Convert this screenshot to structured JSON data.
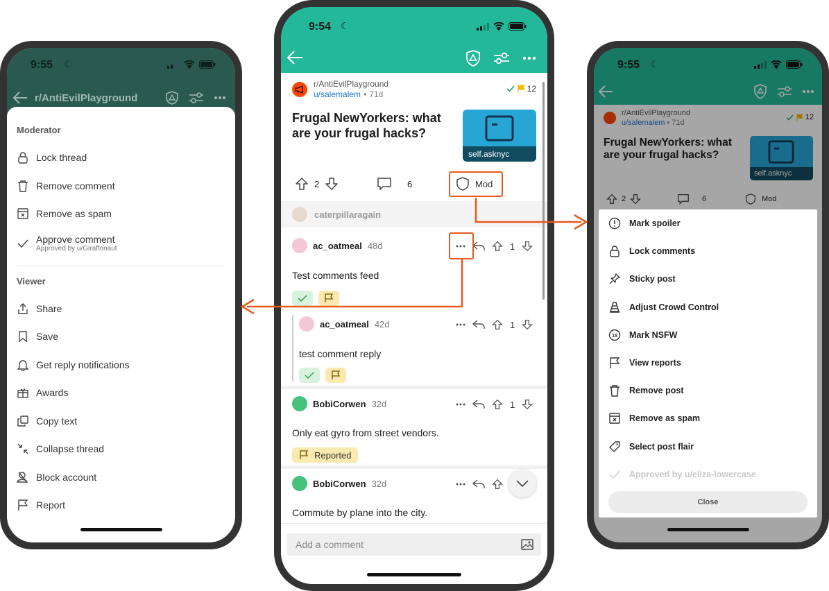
{
  "left_phone": {
    "status": {
      "time": "9:55"
    },
    "appbar": {
      "title": "r/AntiEvilPlayground"
    },
    "moderator_section": {
      "heading": "Moderator",
      "items": [
        {
          "label": "Lock thread",
          "icon": "lock-icon"
        },
        {
          "label": "Remove comment",
          "icon": "trash-icon"
        },
        {
          "label": "Remove as spam",
          "icon": "spam-icon"
        },
        {
          "label": "Approve comment",
          "sublabel": "Approved by u/Giraffonaut",
          "icon": "check-icon"
        }
      ]
    },
    "viewer_section": {
      "heading": "Viewer",
      "items": [
        {
          "label": "Share",
          "icon": "share-icon"
        },
        {
          "label": "Save",
          "icon": "bookmark-icon"
        },
        {
          "label": "Get reply notifications",
          "icon": "bell-icon"
        },
        {
          "label": "Awards",
          "icon": "gift-icon"
        },
        {
          "label": "Copy text",
          "icon": "copy-icon"
        },
        {
          "label": "Collapse thread",
          "icon": "collapse-icon"
        },
        {
          "label": "Block account",
          "icon": "block-user-icon"
        },
        {
          "label": "Report",
          "icon": "flag-icon"
        }
      ]
    }
  },
  "center_phone": {
    "status": {
      "time": "9:54"
    },
    "post": {
      "subreddit": "r/AntiEvilPlayground",
      "author": "u/salemalem",
      "age": "71d",
      "reports_count": "12",
      "title": "Frugal NewYorkers: what are your frugal hacks?",
      "thumbnail_label": "self.asknyc",
      "votes": "2",
      "comments": "6",
      "mod_label": "Mod"
    },
    "collapsed_user": "caterpillaragain",
    "comments": [
      {
        "author": "ac_oatmeal",
        "age": "48d",
        "body": "Test comments feed",
        "votes": "1",
        "chips": [
          "approve",
          "flag"
        ]
      },
      {
        "author": "ac_oatmeal",
        "age": "42d",
        "body": "test comment reply",
        "votes": "1",
        "chips": [
          "approve",
          "flag"
        ],
        "nested": true
      },
      {
        "author": "BobiCorwen",
        "age": "32d",
        "body": "Only eat gyro from street vendors.",
        "votes": "1",
        "reported_label": "Reported"
      },
      {
        "author": "BobiCorwen",
        "age": "32d",
        "body": "Commute by plane into the city.",
        "votes": ""
      }
    ],
    "comment_box": {
      "placeholder": "Add a comment"
    }
  },
  "right_phone": {
    "status": {
      "time": "9:55"
    },
    "post": {
      "subreddit": "r/AntiEvilPlayground",
      "author": "u/salemalem",
      "age": "71d",
      "reports_count": "12",
      "title": "Frugal NewYorkers: what are your frugal hacks?",
      "thumbnail_label": "self.asknyc",
      "votes": "2",
      "comments": "6",
      "mod_label": "Mod"
    },
    "menu": {
      "items": [
        {
          "label": "Mark spoiler",
          "icon": "alert-icon"
        },
        {
          "label": "Lock comments",
          "icon": "lock-icon"
        },
        {
          "label": "Sticky post",
          "icon": "pin-icon"
        },
        {
          "label": "Adjust Crowd Control",
          "icon": "cone-icon"
        },
        {
          "label": "Mark NSFW",
          "icon": "nsfw-icon"
        },
        {
          "label": "View reports",
          "icon": "flag-icon"
        },
        {
          "label": "Remove post",
          "icon": "trash-icon"
        },
        {
          "label": "Remove as spam",
          "icon": "spam-icon"
        },
        {
          "label": "Select post flair",
          "icon": "tag-icon"
        }
      ],
      "approved_label": "Approved by u/eliza-lowercase",
      "close_label": "Close"
    }
  },
  "colors": {
    "accent_teal": "#24b89a",
    "annotation_orange": "#e65a1e",
    "report_flag": "#f5b800"
  }
}
